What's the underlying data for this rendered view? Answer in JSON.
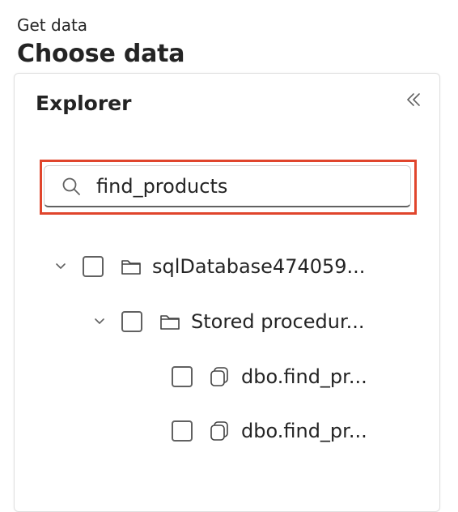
{
  "header": {
    "subtitle": "Get data",
    "title": "Choose data"
  },
  "explorer": {
    "title": "Explorer",
    "collapse_icon": "double-chevron-left-icon",
    "search": {
      "value": "find_products",
      "icon": "search-icon"
    },
    "tree": [
      {
        "label": "sqlDatabase474059...",
        "level": 0,
        "expanded": true,
        "icon": "folder-icon",
        "checked": false
      },
      {
        "label": "Stored procedur...",
        "level": 1,
        "expanded": true,
        "icon": "folder-icon",
        "checked": false
      },
      {
        "label": "dbo.find_pr...",
        "level": 2,
        "icon": "stored-procedure-icon",
        "checked": false
      },
      {
        "label": "dbo.find_pr...",
        "level": 2,
        "icon": "stored-procedure-icon",
        "checked": false
      }
    ]
  },
  "colors": {
    "highlight_border": "#e0452c",
    "text": "#242424",
    "border": "#d1d1d1"
  }
}
